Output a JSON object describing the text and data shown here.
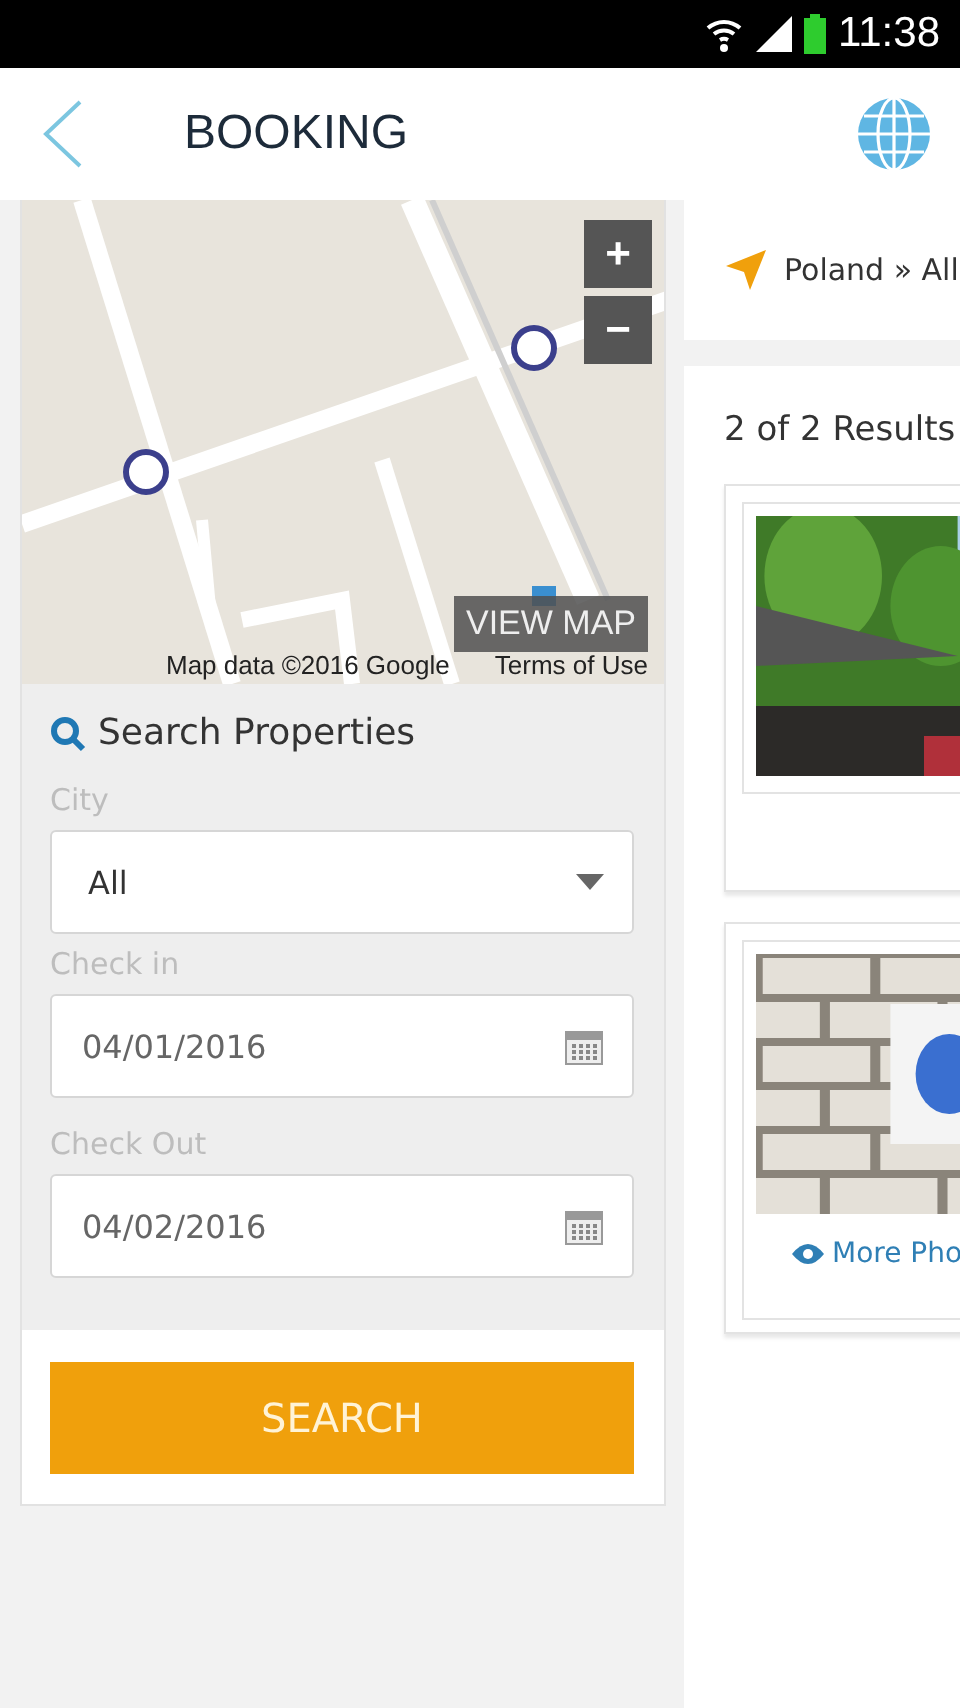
{
  "status_bar": {
    "time": "11:38"
  },
  "header": {
    "title": "BOOKING"
  },
  "map": {
    "kind": "picture",
    "zoom_in": "+",
    "zoom_out": "−",
    "view_button": "VIEW MAP",
    "attribution": "Map data ©2016 Google",
    "terms": "Terms of Use"
  },
  "search": {
    "heading": "Search Properties",
    "fields": [
      {
        "kind": "select",
        "label": "City",
        "value": "All"
      },
      {
        "kind": "date",
        "label": "Check in",
        "value": "04/01/2016"
      },
      {
        "kind": "date",
        "label": "Check Out",
        "value": "04/02/2016"
      }
    ],
    "button": "SEARCH"
  },
  "breadcrumb": "Poland » All",
  "results": {
    "count": "2 of 2 Results",
    "cards": [
      {
        "kind": "terrace"
      },
      {
        "kind": "brick",
        "link": "More Pho"
      }
    ]
  }
}
